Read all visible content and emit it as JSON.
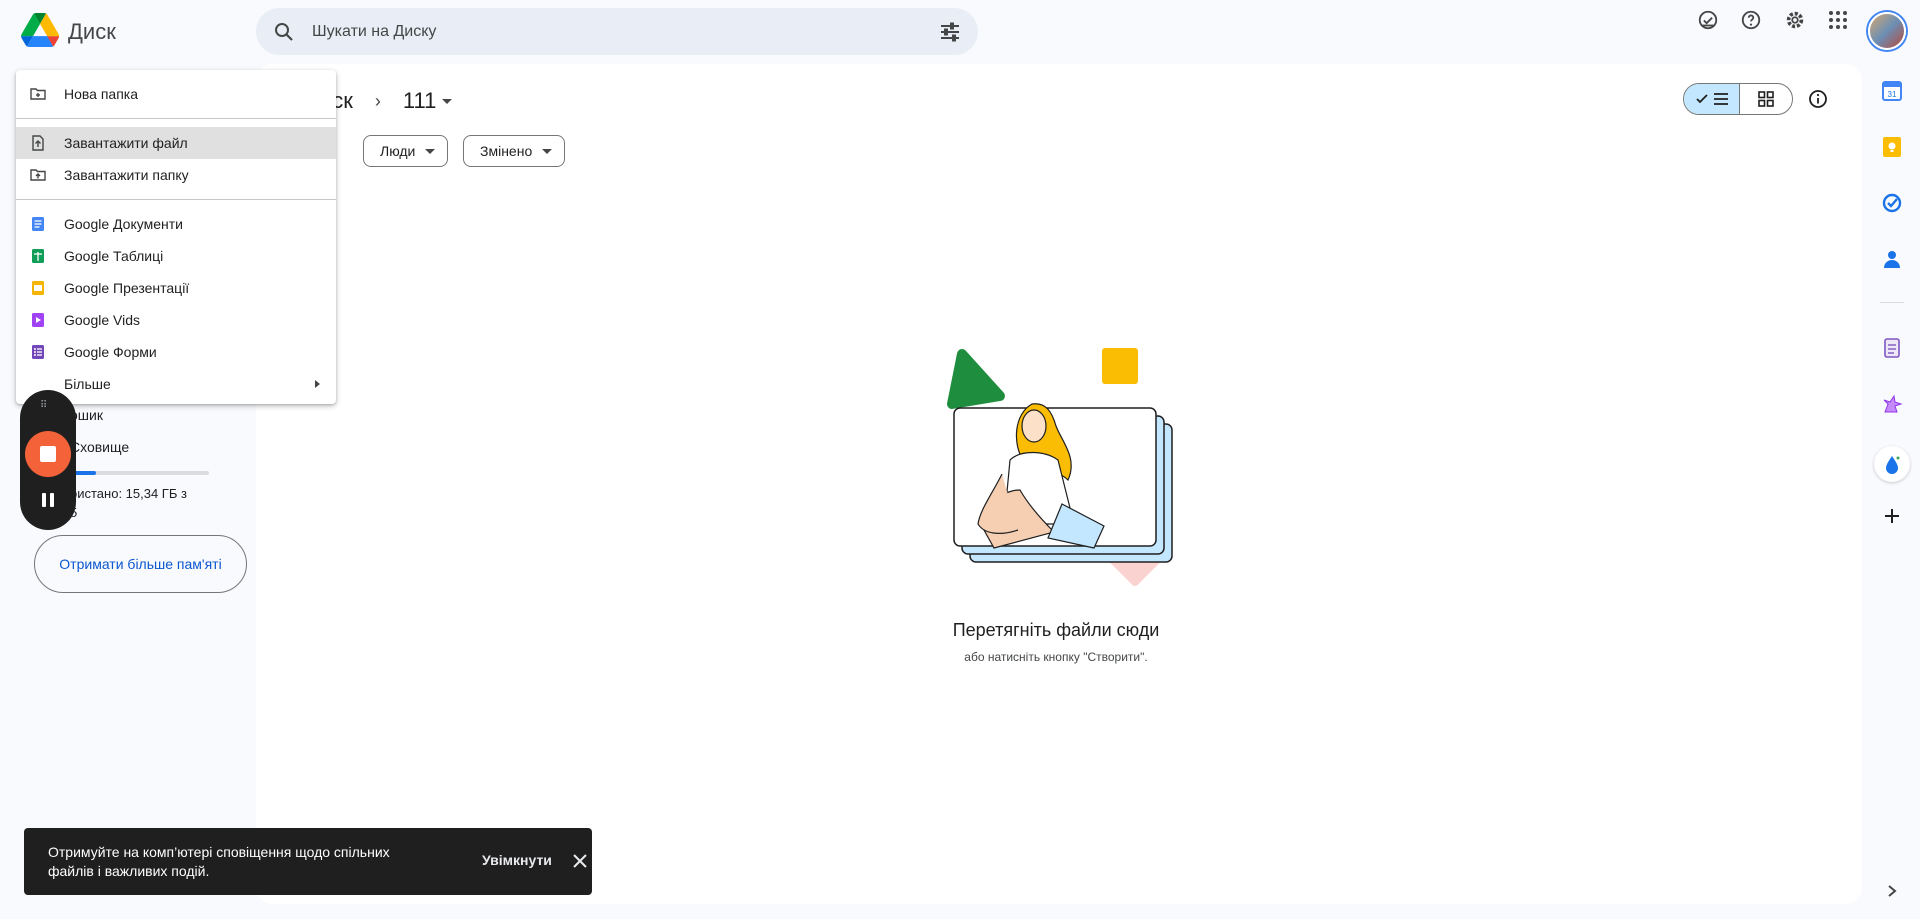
{
  "header": {
    "app_title": "Диск",
    "search_placeholder": "Шукати на Диску"
  },
  "sidebar": {
    "trash_partial": "ошик",
    "storage_partial": "Сховище",
    "usage_line1": "ристано: 15,34 ГБ з",
    "usage_line2": "5",
    "usage_fraction": 0.2,
    "more_storage": "Отримати більше пам'яті"
  },
  "main": {
    "breadcrumb_root": "иск",
    "breadcrumb_separator": "›",
    "current_folder": "111",
    "filters": [
      "Люди",
      "Змінено"
    ],
    "empty_title": "Перетягніть файли сюди",
    "empty_subtitle": "або натисніть кнопку \"Створити\"."
  },
  "menu": {
    "new_folder": "Нова папка",
    "upload_file": "Завантажити файл",
    "upload_folder": "Завантажити папку",
    "docs": "Google Документи",
    "sheets": "Google Таблиці",
    "slides": "Google Презентації",
    "vids": "Google Vids",
    "forms": "Google Форми",
    "more": "Більше"
  },
  "snackbar": {
    "text": "Отримуйте на комп’ютері сповіщення щодо спільних файлів і важливих подій.",
    "action": "Увімкнути"
  },
  "icons": {
    "header": [
      "drive-logo",
      "search-icon",
      "tune-icon",
      "offline-check-icon",
      "help-icon",
      "settings-icon",
      "apps-icon",
      "avatar"
    ],
    "rail": [
      "calendar-icon",
      "keep-icon",
      "tasks-icon",
      "contacts-icon",
      "addon-doc-icon",
      "addon-unicorn-icon",
      "addon-drop-icon",
      "add-icon",
      "expand-icon"
    ]
  },
  "colors": {
    "selected_toggle": "#c2e7ff",
    "accent": "#0b57d0",
    "record": "#f4623a",
    "snackbar": "#1f1f1f"
  }
}
